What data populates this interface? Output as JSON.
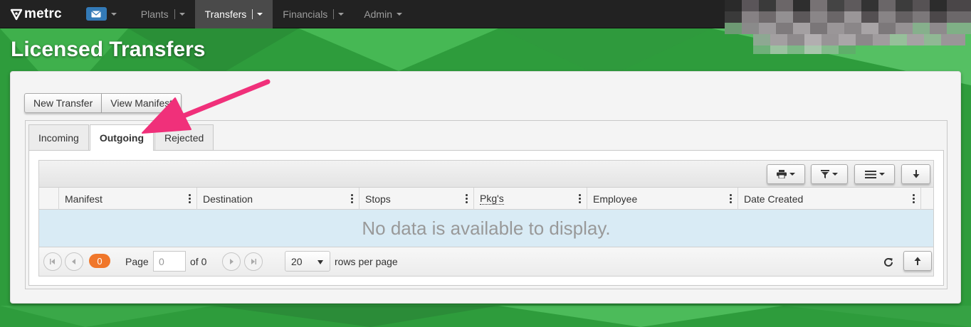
{
  "navbar": {
    "brand": "metrc",
    "mail_icon": "envelope-icon",
    "items": [
      {
        "label": "Plants",
        "active": false
      },
      {
        "label": "Transfers",
        "active": true
      },
      {
        "label": "Financials",
        "active": false
      },
      {
        "label": "Admin",
        "active": false
      }
    ]
  },
  "page": {
    "title": "Licensed Transfers"
  },
  "actions": {
    "new_transfer": "New Transfer",
    "view_manifest": "View Manifest"
  },
  "tabs": [
    {
      "label": "Incoming",
      "active": false
    },
    {
      "label": "Outgoing",
      "active": true
    },
    {
      "label": "Rejected",
      "active": false
    }
  ],
  "grid": {
    "toolbar_icons": [
      "print-icon",
      "filter-icon",
      "columns-menu-icon",
      "download-icon"
    ],
    "columns": [
      "Manifest",
      "Destination",
      "Stops",
      "Pkg's",
      "Employee",
      "Date Created"
    ],
    "empty_message": "No data is available to display."
  },
  "pager": {
    "count_badge": "0",
    "page_label": "Page",
    "page_value": "0",
    "of_label": "of 0",
    "page_size": "20",
    "rows_per_page_label": "rows per page"
  },
  "colors": {
    "navbar_bg": "#222222",
    "active_nav_bg": "#4a4a4a",
    "brand_green": "#2f9e3e",
    "badge_orange": "#f0772b",
    "empty_row_bg": "#d9ebf5",
    "annotation_arrow": "#f0307a"
  }
}
